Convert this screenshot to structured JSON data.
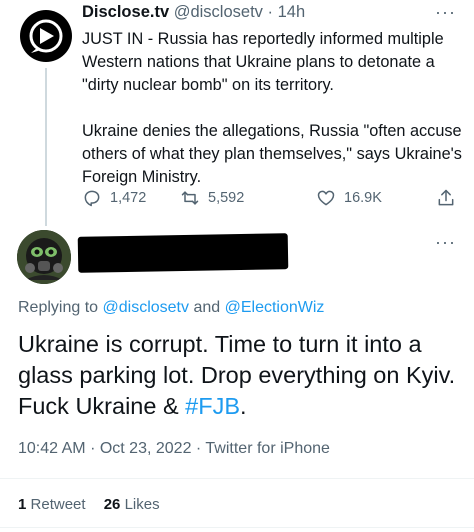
{
  "parent_tweet": {
    "display_name": "Disclose.tv",
    "handle": "@disclosetv",
    "separator": "·",
    "time": "14h",
    "more": "···",
    "paragraph_1": "JUST IN - Russia has reportedly informed multiple Western nations that Ukraine plans to detonate a \"dirty nuclear bomb\" on its territory.",
    "paragraph_2": "Ukraine denies the allegations, Russia \"often accuse others of what they plan themselves,\" says Ukraine's Foreign Ministry.",
    "replies": "1,472",
    "retweets": "5,592",
    "likes": "16.9K"
  },
  "reply_tweet": {
    "more": "···",
    "replying_prefix": "Replying to",
    "replying_handle_1": "@disclosetv",
    "replying_and": "and",
    "replying_handle_2": "@ElectionWiz",
    "text_main": "Ukraine is corrupt. Time to turn it into a glass parking lot. Drop everything on Kyiv. Fuck Ukraine & ",
    "hashtag": "#FJB",
    "text_end": ".",
    "time": "10:42 AM",
    "date_separator": "·",
    "date": "Oct 23, 2022",
    "source_separator": "·",
    "source": "Twitter for iPhone",
    "retweet_count": "1",
    "retweet_label": "Retweet",
    "like_count": "26",
    "like_label": "Likes"
  },
  "colors": {
    "link": "#1d9bf0",
    "secondary_text": "#536471",
    "primary_text": "#0f1419",
    "divider": "#eff3f4"
  },
  "icons": [
    "disclose-logo-icon",
    "more-icon",
    "reply-icon",
    "retweet-icon",
    "like-icon",
    "share-icon",
    "gasmask-avatar-icon"
  ]
}
